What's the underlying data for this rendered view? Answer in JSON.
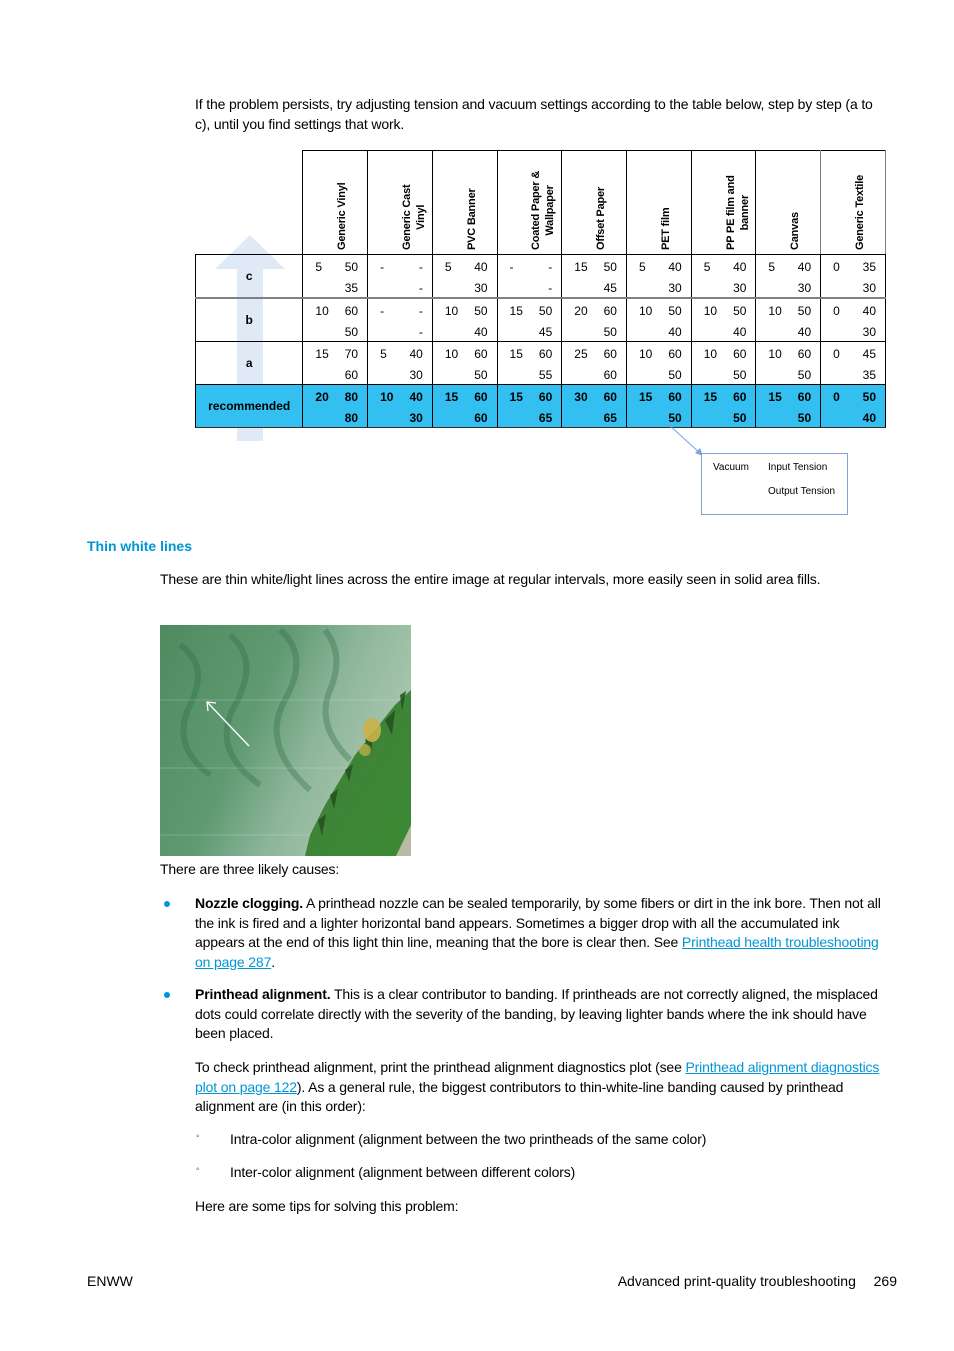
{
  "intro": {
    "text": "If the problem persists, try adjusting tension and vacuum settings according to the table below, step by step (a to c), until you find settings that work."
  },
  "settings_table": {
    "columns": [
      {
        "line1": "Generic Vinyl",
        "line2": ""
      },
      {
        "line1": "Generic Cast",
        "line2": "Vinyl"
      },
      {
        "line1": "PVC Banner",
        "line2": ""
      },
      {
        "line1": "Coated Paper &",
        "line2": "Wallpaper"
      },
      {
        "line1": "Offset Paper",
        "line2": ""
      },
      {
        "line1": "PET film",
        "line2": ""
      },
      {
        "line1": "PP PE film and",
        "line2": "banner"
      },
      {
        "line1": "Canvas",
        "line2": ""
      },
      {
        "line1": "Generic Textile",
        "line2": ""
      }
    ],
    "rows": [
      {
        "label": "c",
        "cells": [
          {
            "vacuum": "5",
            "input": "50",
            "output": "35"
          },
          {
            "vacuum": "-",
            "input": "-",
            "output": "-"
          },
          {
            "vacuum": "5",
            "input": "40",
            "output": "30"
          },
          {
            "vacuum": "-",
            "input": "-",
            "output": "-"
          },
          {
            "vacuum": "15",
            "input": "50",
            "output": "45"
          },
          {
            "vacuum": "5",
            "input": "40",
            "output": "30"
          },
          {
            "vacuum": "5",
            "input": "40",
            "output": "30"
          },
          {
            "vacuum": "5",
            "input": "40",
            "output": "30"
          },
          {
            "vacuum": "0",
            "input": "35",
            "output": "30"
          }
        ]
      },
      {
        "label": "b",
        "cells": [
          {
            "vacuum": "10",
            "input": "60",
            "output": "50"
          },
          {
            "vacuum": "-",
            "input": "-",
            "output": "-"
          },
          {
            "vacuum": "10",
            "input": "50",
            "output": "40"
          },
          {
            "vacuum": "15",
            "input": "50",
            "output": "45"
          },
          {
            "vacuum": "20",
            "input": "60",
            "output": "50"
          },
          {
            "vacuum": "10",
            "input": "50",
            "output": "40"
          },
          {
            "vacuum": "10",
            "input": "50",
            "output": "40"
          },
          {
            "vacuum": "10",
            "input": "50",
            "output": "40"
          },
          {
            "vacuum": "0",
            "input": "40",
            "output": "30"
          }
        ]
      },
      {
        "label": "a",
        "cells": [
          {
            "vacuum": "15",
            "input": "70",
            "output": "60"
          },
          {
            "vacuum": "5",
            "input": "40",
            "output": "30"
          },
          {
            "vacuum": "10",
            "input": "60",
            "output": "50"
          },
          {
            "vacuum": "15",
            "input": "60",
            "output": "55"
          },
          {
            "vacuum": "25",
            "input": "60",
            "output": "60"
          },
          {
            "vacuum": "10",
            "input": "60",
            "output": "50"
          },
          {
            "vacuum": "10",
            "input": "60",
            "output": "50"
          },
          {
            "vacuum": "10",
            "input": "60",
            "output": "50"
          },
          {
            "vacuum": "0",
            "input": "45",
            "output": "35"
          }
        ]
      },
      {
        "label": "recommended",
        "cells": [
          {
            "vacuum": "20",
            "input": "80",
            "output": "80"
          },
          {
            "vacuum": "10",
            "input": "40",
            "output": "30"
          },
          {
            "vacuum": "15",
            "input": "60",
            "output": "60"
          },
          {
            "vacuum": "15",
            "input": "60",
            "output": "65"
          },
          {
            "vacuum": "30",
            "input": "60",
            "output": "65"
          },
          {
            "vacuum": "15",
            "input": "60",
            "output": "50"
          },
          {
            "vacuum": "15",
            "input": "60",
            "output": "50"
          },
          {
            "vacuum": "15",
            "input": "60",
            "output": "50"
          },
          {
            "vacuum": "0",
            "input": "50",
            "output": "40"
          }
        ]
      }
    ],
    "highlight_color": "#33bfef",
    "legend": {
      "vacuum": "Vacuum",
      "input_tension": "Input Tension",
      "output_tension": "Output Tension"
    }
  },
  "section": {
    "title": "Thin white lines",
    "description": "These are thin white/light lines across the entire image at regular intervals, more easily seen in solid area fills.",
    "likely_causes": "There are three likely causes:"
  },
  "photo": {
    "icon": "arrow-pointer-icon"
  },
  "bullets": [
    {
      "bold": "Nozzle clogging.",
      "text": " A printhead nozzle can be sealed temporarily, by some fibers or dirt in the ink bore. Then not all the ink is fired and a lighter horizontal band appears. Sometimes a bigger drop with all the accumulated ink appears at the end of this light thin line, meaning that the bore is clear then. See ",
      "link": "Printhead health troubleshooting on page 287",
      "after": "."
    },
    {
      "bold": "Printhead alignment.",
      "text": " This is a clear contributor to banding. If printheads are not correctly aligned, the misplaced dots could correlate directly with the severity of the banding, by leaving lighter bands where the ink should have been placed."
    }
  ],
  "alignment_check": {
    "before": "To check printhead alignment, print the printhead alignment diagnostics plot (see ",
    "link": "Printhead alignment diagnostics plot on page 122",
    "after": "). As a general rule, the biggest contributors to thin-white-line banding caused by printhead alignment are (in this order):"
  },
  "sub_bullets": [
    "Intra-color alignment (alignment between the two printheads of the same color)",
    "Inter-color alignment (alignment between different colors)"
  ],
  "tips_intro": "Here are some tips for solving this problem:",
  "footer": {
    "left": "ENWW",
    "section": "Advanced print-quality troubleshooting",
    "page": "269"
  },
  "colors": {
    "accent": "#0096d6",
    "highlight": "#33bfef"
  }
}
